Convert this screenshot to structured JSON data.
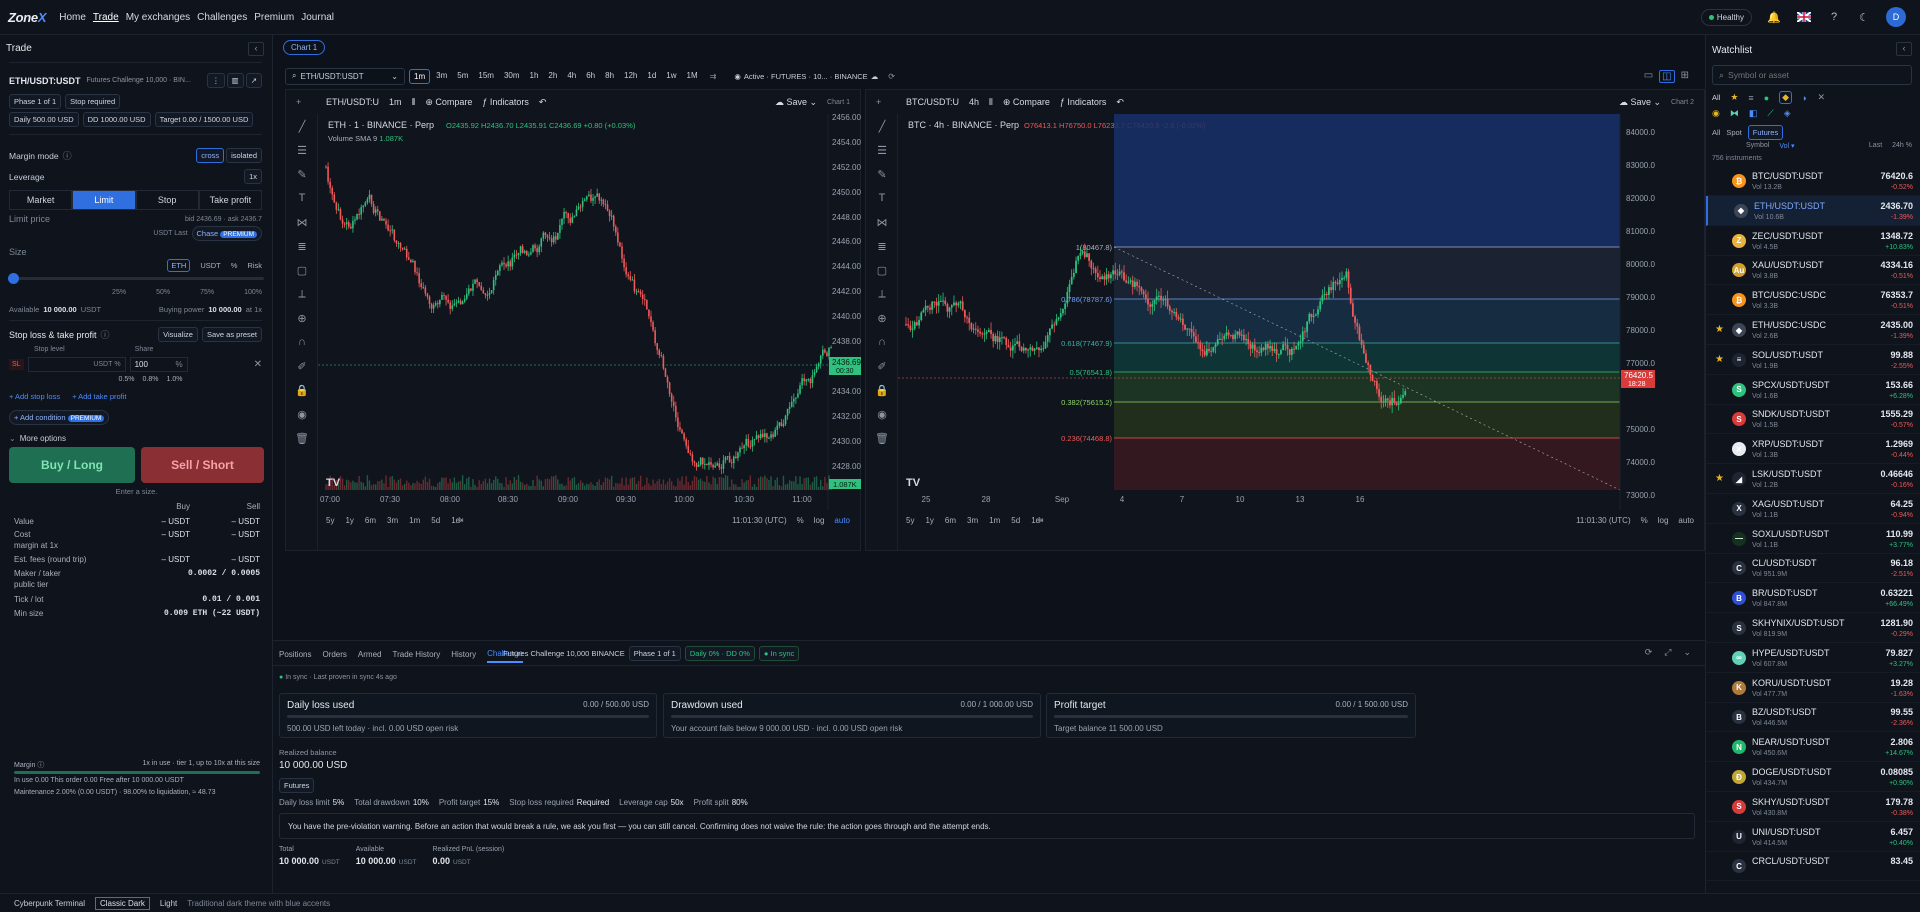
{
  "header": {
    "logo_a": "Zone",
    "logo_b": "X",
    "nav": [
      "Home",
      "Trade",
      "My exchanges",
      "Challenges",
      "Premium",
      "Journal"
    ],
    "status": "Healthy",
    "avatar": "D"
  },
  "trade": {
    "title": "Trade",
    "symbol": "ETH/USDT:USDT",
    "challenge": "Futures Challenge 10,000 · BIN...",
    "phase": "Phase 1 of 1",
    "stop_required": "Stop required",
    "daily": "Daily 500.00 USD",
    "dd": "DD 1000.00 USD",
    "target": "Target 0.00 / 1500.00 USD",
    "margin_mode_label": "Margin mode",
    "cross": "cross",
    "isolated": "isolated",
    "leverage_label": "Leverage",
    "leverage_value": "1x",
    "order_tabs": [
      "Market",
      "Limit",
      "Stop",
      "Take profit"
    ],
    "limit_price_label": "Limit price",
    "bid_ask": "bid 2436.69 · ask 2436.7",
    "usdt_last": "USDT  Last",
    "chase": "Chase",
    "premium": "PREMIUM",
    "size_label": "Size",
    "size_units": [
      "ETH",
      "USDT",
      "%",
      "Risk"
    ],
    "slider_marks": [
      "25%",
      "50%",
      "75%",
      "100%"
    ],
    "available_label": "Available",
    "available_value": "10 000.00",
    "available_unit": "USDT",
    "buying_power_label": "Buying power",
    "buying_power_value": "10 000.00",
    "buying_power_suffix": "at 1x",
    "sltp_title": "Stop loss & take profit",
    "visualize": "Visualize",
    "save_preset": "Save as preset",
    "stop_level": "Stop level",
    "share": "Share",
    "sl": "SL",
    "sl_unit": "USDT",
    "sl_pct": "%",
    "share_value": "100",
    "share_pcts": [
      "0.5%",
      "0.8%",
      "1.0%"
    ],
    "add_stop": "+ Add stop loss",
    "add_tp": "+ Add take profit",
    "add_condition": "+ Add condition",
    "more_options": "More options",
    "buy": "Buy / Long",
    "sell": "Sell / Short",
    "enter_size": "Enter a size.",
    "col_buy": "Buy",
    "col_sell": "Sell",
    "rows": [
      {
        "k": "Value",
        "b": "– USDT",
        "s": "– USDT"
      },
      {
        "k": "Cost",
        "b": "– USDT",
        "s": "– USDT"
      },
      {
        "k": "margin at 1x",
        "b": "",
        "s": ""
      },
      {
        "k": "Est. fees (round trip)",
        "b": "– USDT",
        "s": "– USDT"
      },
      {
        "k": "Maker / taker",
        "b": "0.0002 / 0.0005",
        "s": ""
      },
      {
        "k": "public tier",
        "b": "",
        "s": ""
      },
      {
        "k": "Tick / lot",
        "b": "0.01 / 0.001",
        "s": ""
      },
      {
        "k": "Min size",
        "b": "0.009 ETH (~22 USDT)",
        "s": ""
      }
    ],
    "margin_label": "Margin",
    "margin_note": "1x in use · tier 1, up to 10x at this size",
    "margin_legend": "In use 0.00  This order 0.00  Free after 10 000.00 USDT",
    "maintenance": "Maintenance 2.00% (0.00 USDT) · 98.00% to liquidation, ≈ 48.73"
  },
  "chart_tab": "Chart 1",
  "toolbar": {
    "symbol": "ETH/USDT:USDT",
    "timeframes": [
      "1m",
      "3m",
      "5m",
      "15m",
      "30m",
      "1h",
      "2h",
      "4h",
      "6h",
      "8h",
      "12h",
      "1d",
      "1w",
      "1M"
    ],
    "active": "Active · FUTURES · 10... · BINANCE"
  },
  "chart1": {
    "symbol": "ETH/USDT:U",
    "tf": "1m",
    "compare": "Compare",
    "indicators": "Indicators",
    "save": "Save",
    "title": "ETH · 1 · BINANCE · Perp",
    "ohlc": "O2435.92 H2436.70 L2435.91 C2436.69 +0.80 (+0.03%)",
    "volume": "Volume SMA 9",
    "volume_value": "1.087K",
    "price_tag": "2436.69",
    "price_tag_time": "00:30",
    "vol_tag": "1.087K",
    "label": "Chart 1",
    "time_axis": [
      "07:00",
      "07:30",
      "08:00",
      "08:30",
      "09:00",
      "09:30",
      "10:00",
      "10:30",
      "11:00"
    ],
    "price_axis": [
      "2456.00",
      "2454.00",
      "2452.00",
      "2450.00",
      "2448.00",
      "2446.00",
      "2444.00",
      "2442.00",
      "2440.00",
      "2438.00",
      "2434.00",
      "2432.00",
      "2430.00",
      "2428.00"
    ],
    "ranges": [
      "5y",
      "1y",
      "6m",
      "3m",
      "1m",
      "5d",
      "1d"
    ],
    "clock": "11:01:30 (UTC)",
    "pct": "%",
    "log": "log",
    "auto": "auto"
  },
  "chart2": {
    "symbol": "BTC/USDT:U",
    "tf": "4h",
    "compare": "Compare",
    "indicators": "Indicators",
    "save": "Save",
    "title": "BTC · 4h · BINANCE · Perp",
    "ohlc": "O76413.1 H76750.0 L76233.7 C76420.5 -2.6 (-0.02%)",
    "price_tag": "76420.5",
    "price_tag_time": "18:28",
    "label": "Chart 2",
    "fib": [
      "1(80467.8)",
      "0.786(78787.6)",
      "0.618(77467.9)",
      "0.5(76541.8)",
      "0.382(75615.2)",
      "0.236(74468.8)"
    ],
    "time_axis": [
      "25",
      "28",
      "Sep",
      "4",
      "7",
      "10",
      "13",
      "16"
    ],
    "price_axis": [
      "84000.0",
      "83000.0",
      "82000.0",
      "81000.0",
      "80000.0",
      "79000.0",
      "78000.0",
      "77000.0",
      "75000.0",
      "74000.0",
      "73000.0"
    ],
    "ranges": [
      "5y",
      "1y",
      "6m",
      "3m",
      "1m",
      "5d",
      "1d"
    ],
    "clock": "11:01:30 (UTC)",
    "pct": "%",
    "log": "log",
    "auto": "auto"
  },
  "bottom": {
    "tabs": [
      "Positions",
      "Orders",
      "Armed",
      "Trade History",
      "History",
      "Challenge"
    ],
    "challenge_name": "Futures Challenge 10,000 BINANCE",
    "phase": "Phase 1 of 1",
    "daily_dd": "Daily 0% · DD 0%",
    "in_sync": "In sync",
    "sync_note": "In sync · Last proven in sync 4s ago",
    "cards": [
      {
        "title": "Daily loss used",
        "value": "0.00 / 500.00 USD",
        "sub": "500.00 USD left today · incl. 0.00 USD open risk"
      },
      {
        "title": "Drawdown used",
        "value": "0.00 / 1 000.00 USD",
        "sub": "Your account fails below 9 000.00 USD · incl. 0.00 USD open risk"
      },
      {
        "title": "Profit target",
        "value": "0.00 / 1 500.00 USD",
        "sub": "Target balance 11 500.00 USD"
      }
    ],
    "realized_label": "Realized balance",
    "realized_value": "10 000.00 USD",
    "futures": "Futures",
    "rules": [
      {
        "k": "Daily loss limit",
        "v": "5%"
      },
      {
        "k": "Total drawdown",
        "v": "10%"
      },
      {
        "k": "Profit target",
        "v": "15%"
      },
      {
        "k": "Stop loss required",
        "v": "Required"
      },
      {
        "k": "Leverage cap",
        "v": "50x"
      },
      {
        "k": "Profit split",
        "v": "80%"
      }
    ],
    "warning": "You have the pre-violation warning. Before an action that would break a rule, we ask you first — you can still cancel. Confirming does not waive the rule: the action goes through and the attempt ends.",
    "totals": [
      {
        "k": "Total",
        "v": "10 000.00",
        "u": "USDT"
      },
      {
        "k": "Available",
        "v": "10 000.00",
        "u": "USDT"
      },
      {
        "k": "Realized PnL (session)",
        "v": "0.00",
        "u": "USDT"
      }
    ]
  },
  "watchlist": {
    "title": "Watchlist",
    "placeholder": "Symbol or asset",
    "filters": [
      "All",
      "Spot",
      "Futures"
    ],
    "col_symbol": "Symbol",
    "col_vol": "Vol",
    "col_last": "Last",
    "col_chg": "24h %",
    "count": "756 instruments",
    "items": [
      {
        "sym": "BTC/USDT:USDT",
        "vol": "Vol 13.2B",
        "price": "76420.6",
        "chg": "-0.52%",
        "color": "#f7931a",
        "glyph": "₿",
        "star": false,
        "sel": false
      },
      {
        "sym": "ETH/USDT:USDT",
        "vol": "Vol 10.6B",
        "price": "2436.70",
        "chg": "-1.39%",
        "color": "#3c4457",
        "glyph": "◆",
        "star": false,
        "sel": true
      },
      {
        "sym": "ZEC/USDT:USDT",
        "vol": "Vol 4.5B",
        "price": "1348.72",
        "chg": "+10.83%",
        "color": "#e9b23a",
        "glyph": "Z",
        "star": false,
        "sel": false
      },
      {
        "sym": "XAU/USDT:USDT",
        "vol": "Vol 3.8B",
        "price": "4334.16",
        "chg": "-0.51%",
        "color": "#d4a02a",
        "glyph": "Au",
        "star": false,
        "sel": false
      },
      {
        "sym": "BTC/USDC:USDC",
        "vol": "Vol 3.3B",
        "price": "76353.7",
        "chg": "-0.51%",
        "color": "#f7931a",
        "glyph": "₿",
        "star": false,
        "sel": false
      },
      {
        "sym": "ETH/USDC:USDC",
        "vol": "Vol 2.6B",
        "price": "2435.00",
        "chg": "-1.39%",
        "color": "#3c4457",
        "glyph": "◆",
        "star": true,
        "sel": false
      },
      {
        "sym": "SOL/USDT:USDT",
        "vol": "Vol 1.9B",
        "price": "99.88",
        "chg": "-2.55%",
        "color": "#1f2433",
        "glyph": "≡",
        "star": true,
        "sel": false
      },
      {
        "sym": "SPCX/USDT:USDT",
        "vol": "Vol 1.6B",
        "price": "153.66",
        "chg": "+6.28%",
        "color": "#2ec27e",
        "glyph": "S",
        "star": false,
        "sel": false
      },
      {
        "sym": "SNDK/USDT:USDT",
        "vol": "Vol 1.5B",
        "price": "1555.29",
        "chg": "-0.57%",
        "color": "#d93a3a",
        "glyph": "S",
        "star": false,
        "sel": false
      },
      {
        "sym": "XRP/USDT:USDT",
        "vol": "Vol 1.3B",
        "price": "1.2969",
        "chg": "-0.44%",
        "color": "#e8ecf2",
        "glyph": "✕",
        "star": false,
        "sel": false
      },
      {
        "sym": "LSK/USDT:USDT",
        "vol": "Vol 1.2B",
        "price": "0.46646",
        "chg": "-0.16%",
        "color": "#1f2433",
        "glyph": "◢",
        "star": true,
        "sel": false
      },
      {
        "sym": "XAG/USDT:USDT",
        "vol": "Vol 1.1B",
        "price": "64.25",
        "chg": "-0.94%",
        "color": "#2a3140",
        "glyph": "X",
        "star": false,
        "sel": false
      },
      {
        "sym": "SOXL/USDT:USDT",
        "vol": "Vol 1.1B",
        "price": "110.99",
        "chg": "+3.77%",
        "color": "#14331f",
        "glyph": "—",
        "star": false,
        "sel": false
      },
      {
        "sym": "CL/USDT:USDT",
        "vol": "Vol 951.9M",
        "price": "96.18",
        "chg": "-2.51%",
        "color": "#2a3140",
        "glyph": "C",
        "star": false,
        "sel": false
      },
      {
        "sym": "BR/USDT:USDT",
        "vol": "Vol 847.8M",
        "price": "0.63221",
        "chg": "+66.49%",
        "color": "#2f4fd6",
        "glyph": "B",
        "star": false,
        "sel": false
      },
      {
        "sym": "SKHYNIX/USDT:USDT",
        "vol": "Vol 819.9M",
        "price": "1281.90",
        "chg": "-0.29%",
        "color": "#2a3140",
        "glyph": "S",
        "star": false,
        "sel": false
      },
      {
        "sym": "HYPE/USDT:USDT",
        "vol": "Vol 607.8M",
        "price": "79.827",
        "chg": "+3.27%",
        "color": "#5fd1b5",
        "glyph": "∞",
        "star": false,
        "sel": false
      },
      {
        "sym": "KORU/USDT:USDT",
        "vol": "Vol 477.7M",
        "price": "19.28",
        "chg": "-1.63%",
        "color": "#b07a3a",
        "glyph": "K",
        "star": false,
        "sel": false
      },
      {
        "sym": "BZ/USDT:USDT",
        "vol": "Vol 446.5M",
        "price": "99.55",
        "chg": "-2.36%",
        "color": "#2a3140",
        "glyph": "B",
        "star": false,
        "sel": false
      },
      {
        "sym": "NEAR/USDT:USDT",
        "vol": "Vol 450.6M",
        "price": "2.806",
        "chg": "+14.67%",
        "color": "#1fb86a",
        "glyph": "N",
        "star": false,
        "sel": false
      },
      {
        "sym": "DOGE/USDT:USDT",
        "vol": "Vol 434.7M",
        "price": "0.08085",
        "chg": "+0.90%",
        "color": "#c2a633",
        "glyph": "Ð",
        "star": false,
        "sel": false
      },
      {
        "sym": "SKHY/USDT:USDT",
        "vol": "Vol 430.8M",
        "price": "179.78",
        "chg": "-0.38%",
        "color": "#d93a3a",
        "glyph": "S",
        "star": false,
        "sel": false
      },
      {
        "sym": "UNI/USDT:USDT",
        "vol": "Vol 414.5M",
        "price": "6.457",
        "chg": "+0.40%",
        "color": "#1f2433",
        "glyph": "U",
        "star": false,
        "sel": false
      },
      {
        "sym": "CRCL/USDT:USDT",
        "vol": "",
        "price": "83.45",
        "chg": "",
        "color": "#2a3140",
        "glyph": "C",
        "star": false,
        "sel": false
      }
    ]
  },
  "footer": {
    "themes": [
      "Cyberpunk Terminal",
      "Classic Dark",
      "Light"
    ],
    "desc": "Traditional dark theme with blue accents"
  },
  "colors": {
    "accent": "#2f6fe0",
    "up": "#2ec27e",
    "down": "#f05a5a",
    "buy": "#1f6f52",
    "sell": "#8a2f34"
  }
}
